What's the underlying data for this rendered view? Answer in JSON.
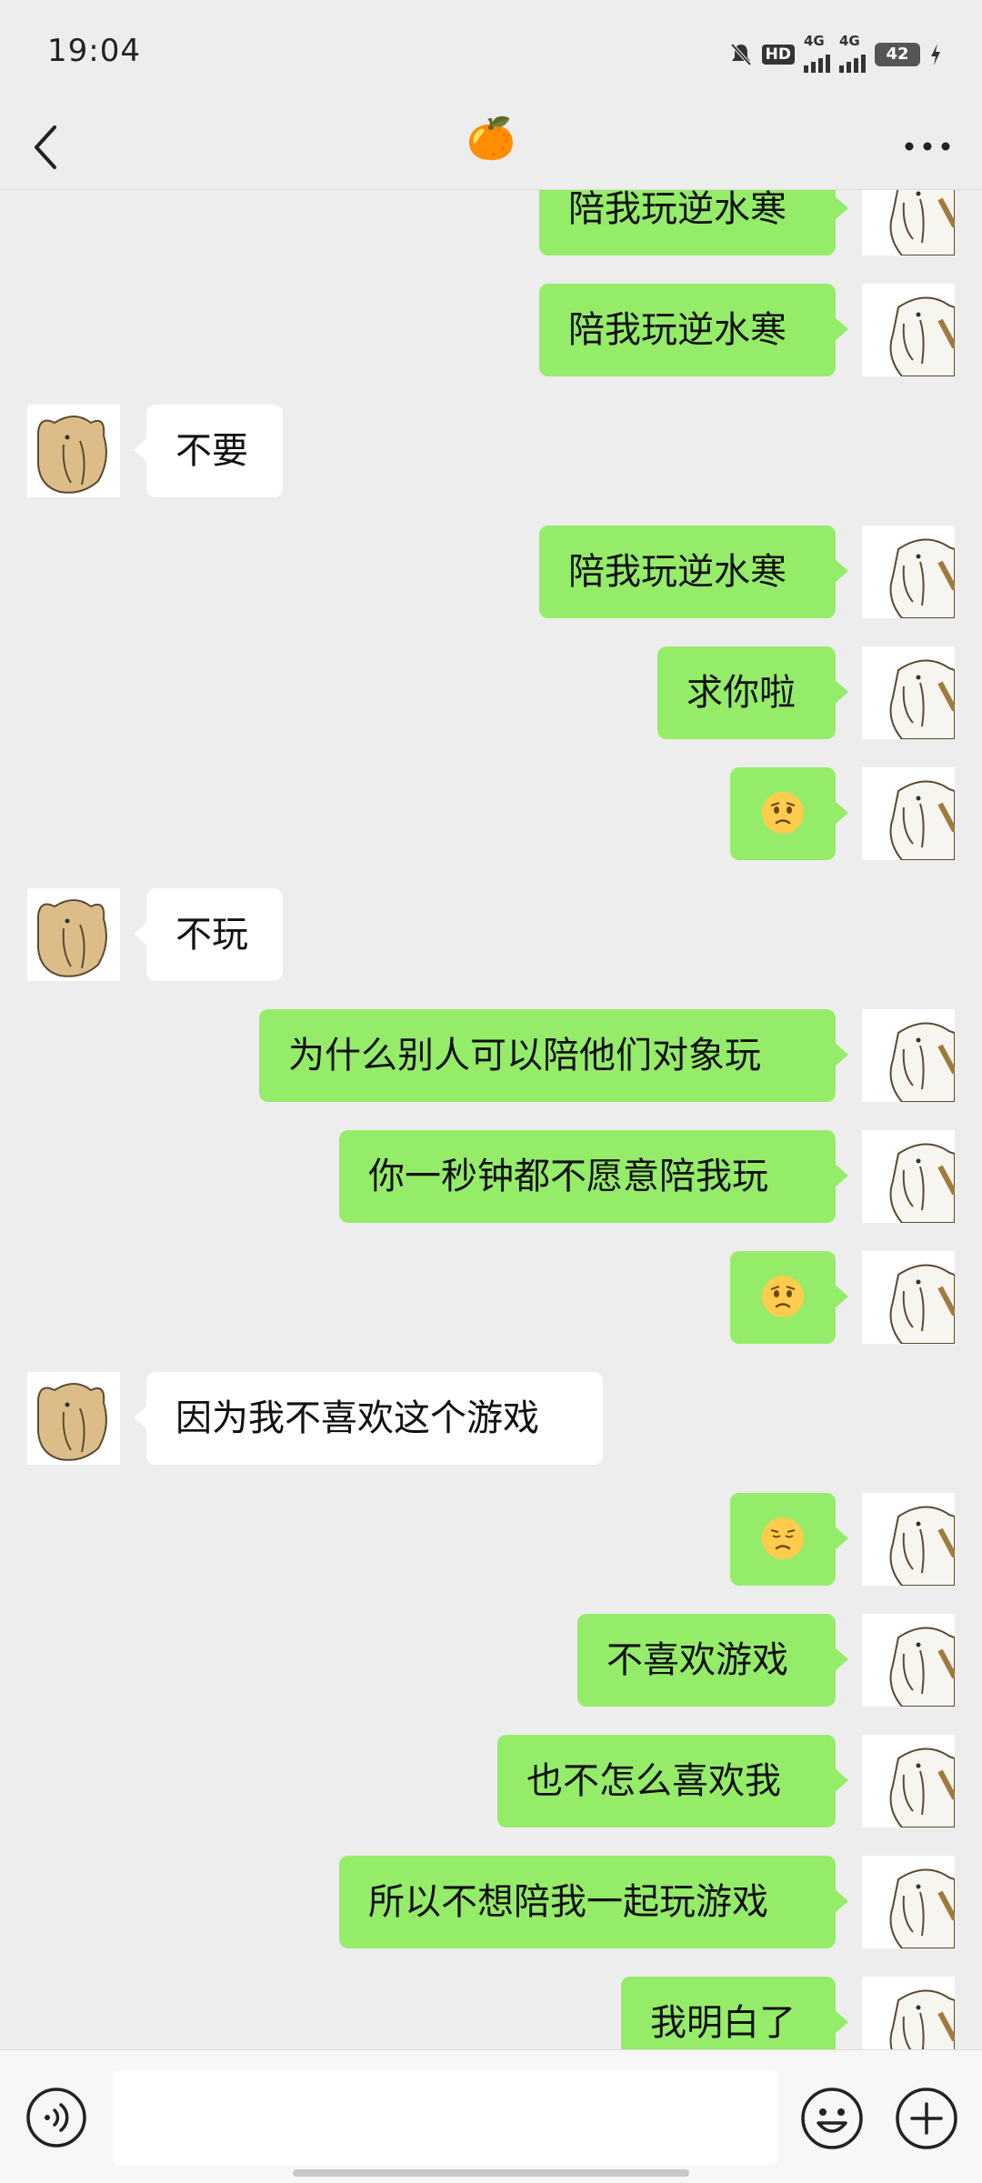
{
  "status_bar": {
    "time": "19:04",
    "hd_label": "HD",
    "signal_1": "4G",
    "signal_2": "4G",
    "battery": "42"
  },
  "header": {
    "title": "🍊"
  },
  "input_bar": {
    "placeholder": ""
  },
  "messages": [
    {
      "side": "out",
      "text": "陪我玩逆水寒"
    },
    {
      "side": "out",
      "text": "陪我玩逆水寒"
    },
    {
      "side": "in",
      "text": "不要"
    },
    {
      "side": "out",
      "text": "陪我玩逆水寒"
    },
    {
      "side": "out",
      "text": "求你啦"
    },
    {
      "side": "out",
      "emoji": "frowning-face"
    },
    {
      "side": "in",
      "text": "不玩"
    },
    {
      "side": "out",
      "text": "为什么别人可以陪他们对象玩"
    },
    {
      "side": "out",
      "text": "你一秒钟都不愿意陪我玩"
    },
    {
      "side": "out",
      "emoji": "frowning-face"
    },
    {
      "side": "in",
      "text": "因为我不喜欢这个游戏"
    },
    {
      "side": "out",
      "emoji": "pensive-face"
    },
    {
      "side": "out",
      "text": "不喜欢游戏"
    },
    {
      "side": "out",
      "text": "也不怎么喜欢我"
    },
    {
      "side": "out",
      "text": "所以不想陪我一起玩游戏"
    },
    {
      "side": "out",
      "text": "我明白了"
    }
  ],
  "colors": {
    "background": "#ededed",
    "outgoing_bubble": "#95ec69",
    "incoming_bubble": "#ffffff",
    "emoji_face": "#ffcc4d"
  },
  "icons": {
    "back": "chevron-left-icon",
    "more": "more-dots-icon",
    "voice": "voice-icon",
    "emoji": "smiley-icon",
    "plus": "plus-icon"
  }
}
